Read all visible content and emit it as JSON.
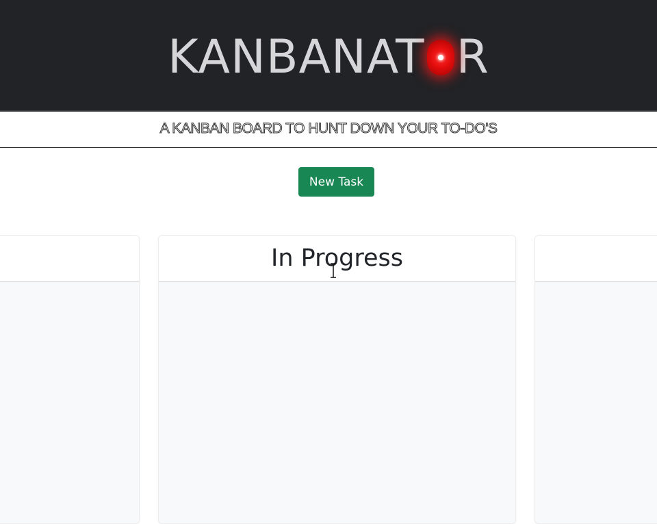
{
  "header": {
    "brand_prefix": "KANBANAT",
    "brand_suffix": "R",
    "brand_eye": "eye-icon",
    "brand_color": "#d6d6d8",
    "background": "#222326",
    "eye_color": "#e30d0d"
  },
  "tagline": "A KANBAN BOARD TO HUNT DOWN YOUR TO-DO'S",
  "toolbar": {
    "new_task_label": "New Task",
    "accent": "#198754"
  },
  "columns": [
    {
      "title": ""
    },
    {
      "title": "In Progress"
    },
    {
      "title": ""
    }
  ],
  "cursor": "text-cursor-icon"
}
